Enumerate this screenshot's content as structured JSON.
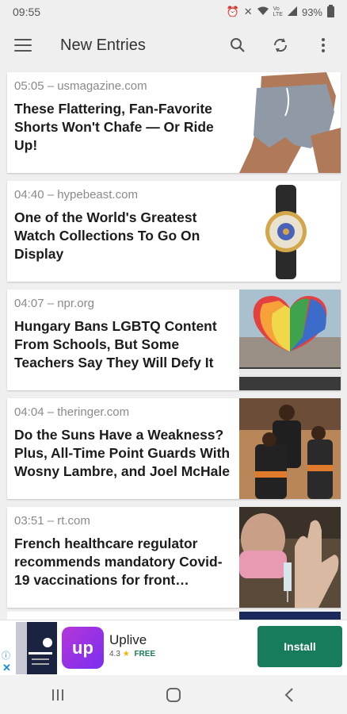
{
  "status": {
    "time": "09:55",
    "battery": "93%",
    "icons": [
      "alarm-icon",
      "mute-icon",
      "wifi-icon",
      "volte-icon",
      "signal-icon",
      "battery-icon"
    ]
  },
  "appbar": {
    "title": "New Entries",
    "icons": [
      "menu-icon",
      "search-icon",
      "refresh-icon",
      "more-vert-icon"
    ]
  },
  "entries": [
    {
      "time": "05:05",
      "source": "usmagazine.com",
      "meta": "05:05 – usmagazine.com",
      "title": "These Flattering, Fan-Favorite Shorts Won't Chafe — Or Ride Up!",
      "thumb": "shorts"
    },
    {
      "time": "04:40",
      "source": "hypebeast.com",
      "meta": "04:40 – hypebeast.com",
      "title": "One of the World's Greatest Watch Collections To Go On Display",
      "thumb": "watch"
    },
    {
      "time": "04:07",
      "source": "npr.org",
      "meta": "04:07 – npr.org",
      "title": "Hungary Bans LGBTQ Content From Schools, But Some Teachers Say They Will Defy It",
      "thumb": "balloon"
    },
    {
      "time": "04:04",
      "source": "theringer.com",
      "meta": "04:04 – theringer.com",
      "title": "Do the Suns Have a Weakness? Plus, All-Time Point Guards With Wosny Lambre, and Joel McHale",
      "thumb": "basketball"
    },
    {
      "time": "03:51",
      "source": "rt.com",
      "meta": "03:51 – rt.com",
      "title": "French healthcare regulator recommends mandatory Covid-19 vaccinations for front…",
      "thumb": "vaccine"
    }
  ],
  "ad": {
    "app_name": "Uplive",
    "rating": "4.3",
    "star": "★",
    "price": "FREE",
    "icon_text": "up",
    "install_label": "Install",
    "brand_color": "#177c5c"
  },
  "navbar": {
    "icons": [
      "recents-icon",
      "home-icon",
      "back-icon"
    ]
  }
}
